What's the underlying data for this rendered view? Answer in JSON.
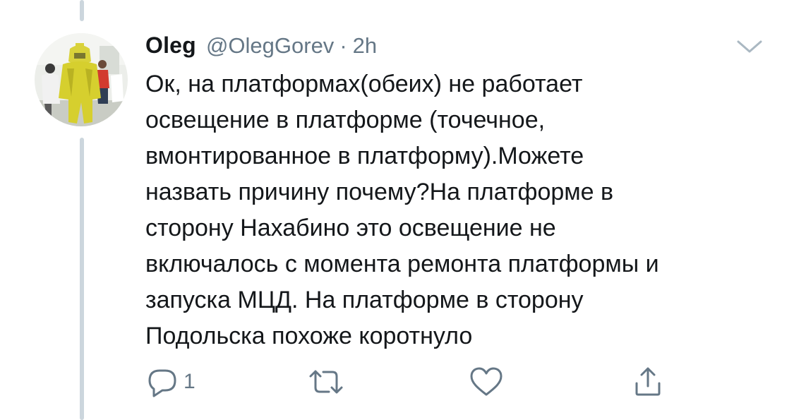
{
  "tweet": {
    "display_name": "Oleg",
    "handle": "@OlegGorev",
    "separator": "·",
    "time": "2h",
    "text_lines": [
      "Ок, на платформах(обеих) не работает",
      "освещение в платформе (точечное,",
      "вмонтированное в платформу).Можете",
      "назвать причину почему?На платформе в",
      "сторону Нахабино это освещение не",
      "включалось с момента ремонта платформы и",
      "запуска МЦД. На платформе в сторону",
      "Подольска похоже коротнуло"
    ]
  },
  "actions": {
    "reply_count": "1",
    "icons": {
      "reply": "reply-icon",
      "retweet": "retweet-icon",
      "like": "heart-icon",
      "share": "share-icon",
      "menu": "chevron-down-icon"
    }
  },
  "colors": {
    "text": "#14171a",
    "secondary": "#657786",
    "thread_line": "#ccd6dd"
  }
}
